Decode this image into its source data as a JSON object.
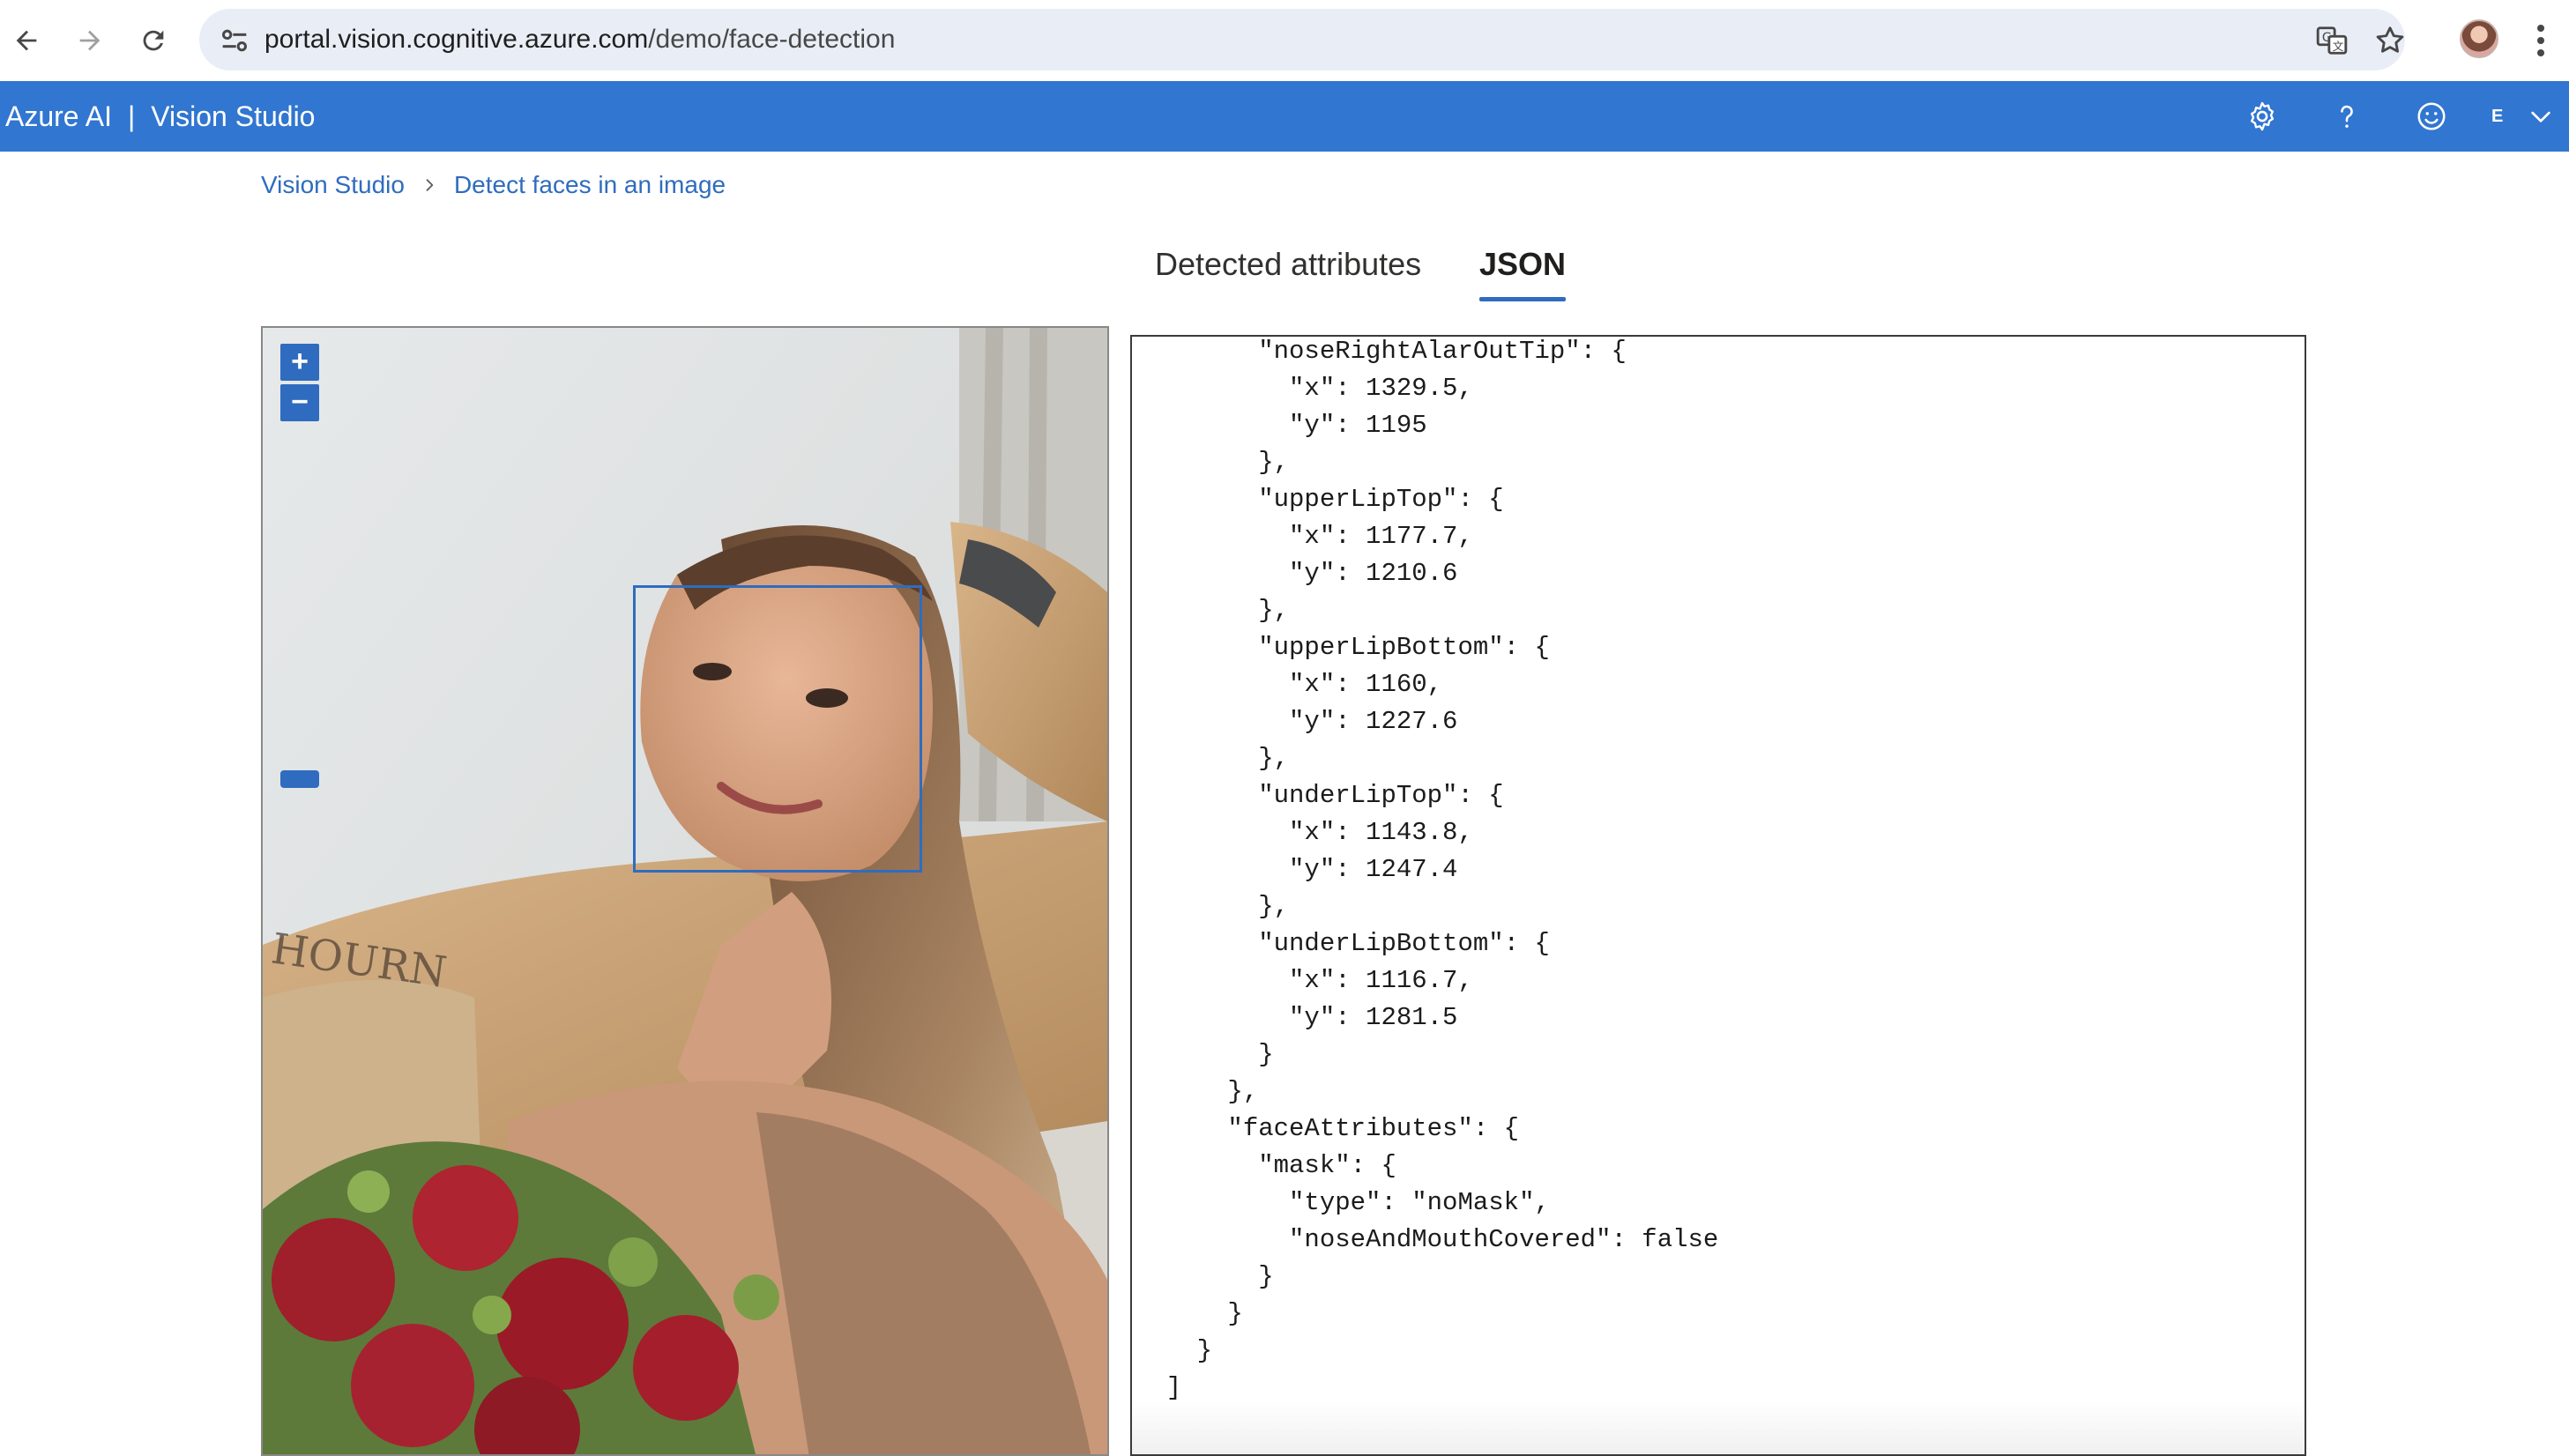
{
  "browser": {
    "url_host": "portal.vision.cognitive.azure.com",
    "url_path": "/demo/face-detection"
  },
  "app": {
    "brand": "Azure AI",
    "product": "Vision Studio",
    "user_initial": "E"
  },
  "breadcrumb": {
    "items": [
      {
        "label": "Vision Studio"
      },
      {
        "label": "Detect faces in an image"
      }
    ]
  },
  "tabs": [
    {
      "label": "Detected attributes",
      "active": false
    },
    {
      "label": "JSON",
      "active": true
    }
  ],
  "image_viewer": {
    "zoom_in_label": "+",
    "zoom_out_label": "−"
  },
  "json_view": {
    "lines": [
      "        \"noseRightAlarOutTip\": {",
      "          \"x\": 1329.5,",
      "          \"y\": 1195",
      "        },",
      "        \"upperLipTop\": {",
      "          \"x\": 1177.7,",
      "          \"y\": 1210.6",
      "        },",
      "        \"upperLipBottom\": {",
      "          \"x\": 1160,",
      "          \"y\": 1227.6",
      "        },",
      "        \"underLipTop\": {",
      "          \"x\": 1143.8,",
      "          \"y\": 1247.4",
      "        },",
      "        \"underLipBottom\": {",
      "          \"x\": 1116.7,",
      "          \"y\": 1281.5",
      "        }",
      "      },",
      "      \"faceAttributes\": {",
      "        \"mask\": {",
      "          \"type\": \"noMask\",",
      "          \"noseAndMouthCovered\": false",
      "        }",
      "      }",
      "    }",
      "  ]"
    ]
  },
  "colors": {
    "header_bg": "#3176d0",
    "accent": "#2f6cbf",
    "face_box": "#2f6cbf"
  }
}
